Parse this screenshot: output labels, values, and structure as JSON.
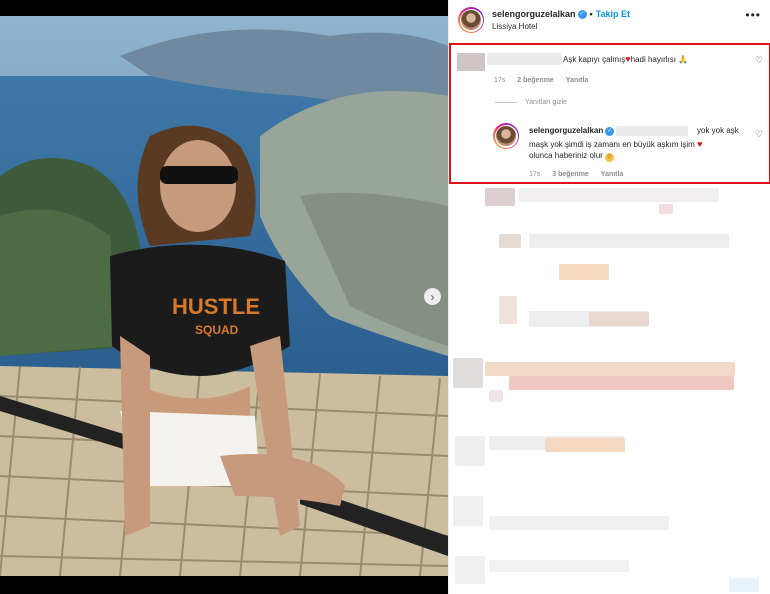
{
  "post": {
    "username": "selengorguzelalkan",
    "follow_label": "Takip Et",
    "location": "Lissiya Hotel",
    "more_label": "•••"
  },
  "photo": {
    "shirt_text_1": "HUSTLE",
    "shirt_text_2": "SQUAD"
  },
  "comment": {
    "text_before": "Aşk kapıyı çalmış",
    "text_after": "hadi hayırlısı",
    "emoji": "🙏",
    "time": "17s",
    "likes": "2 beğenme",
    "reply_label": "Yanıtla"
  },
  "hide_replies_label": "Yanıtları gizle",
  "reply": {
    "username": "selengorguzelalkan",
    "line1": "yok yok aşk",
    "line2": "maşk yok şimdi iş zamanı en büyük aşkım işim",
    "line3": "olunca haberiniz olur",
    "time": "17s",
    "likes": "3 beğenme",
    "reply_label": "Yanıtla"
  },
  "icons": {
    "like": "heart-outline-icon",
    "next": "chevron-right-icon",
    "verified": "verified-badge-icon"
  },
  "colors": {
    "highlight_border": "#e0111c",
    "follow_blue": "#0095f6",
    "heart_red": "#e0111c"
  }
}
